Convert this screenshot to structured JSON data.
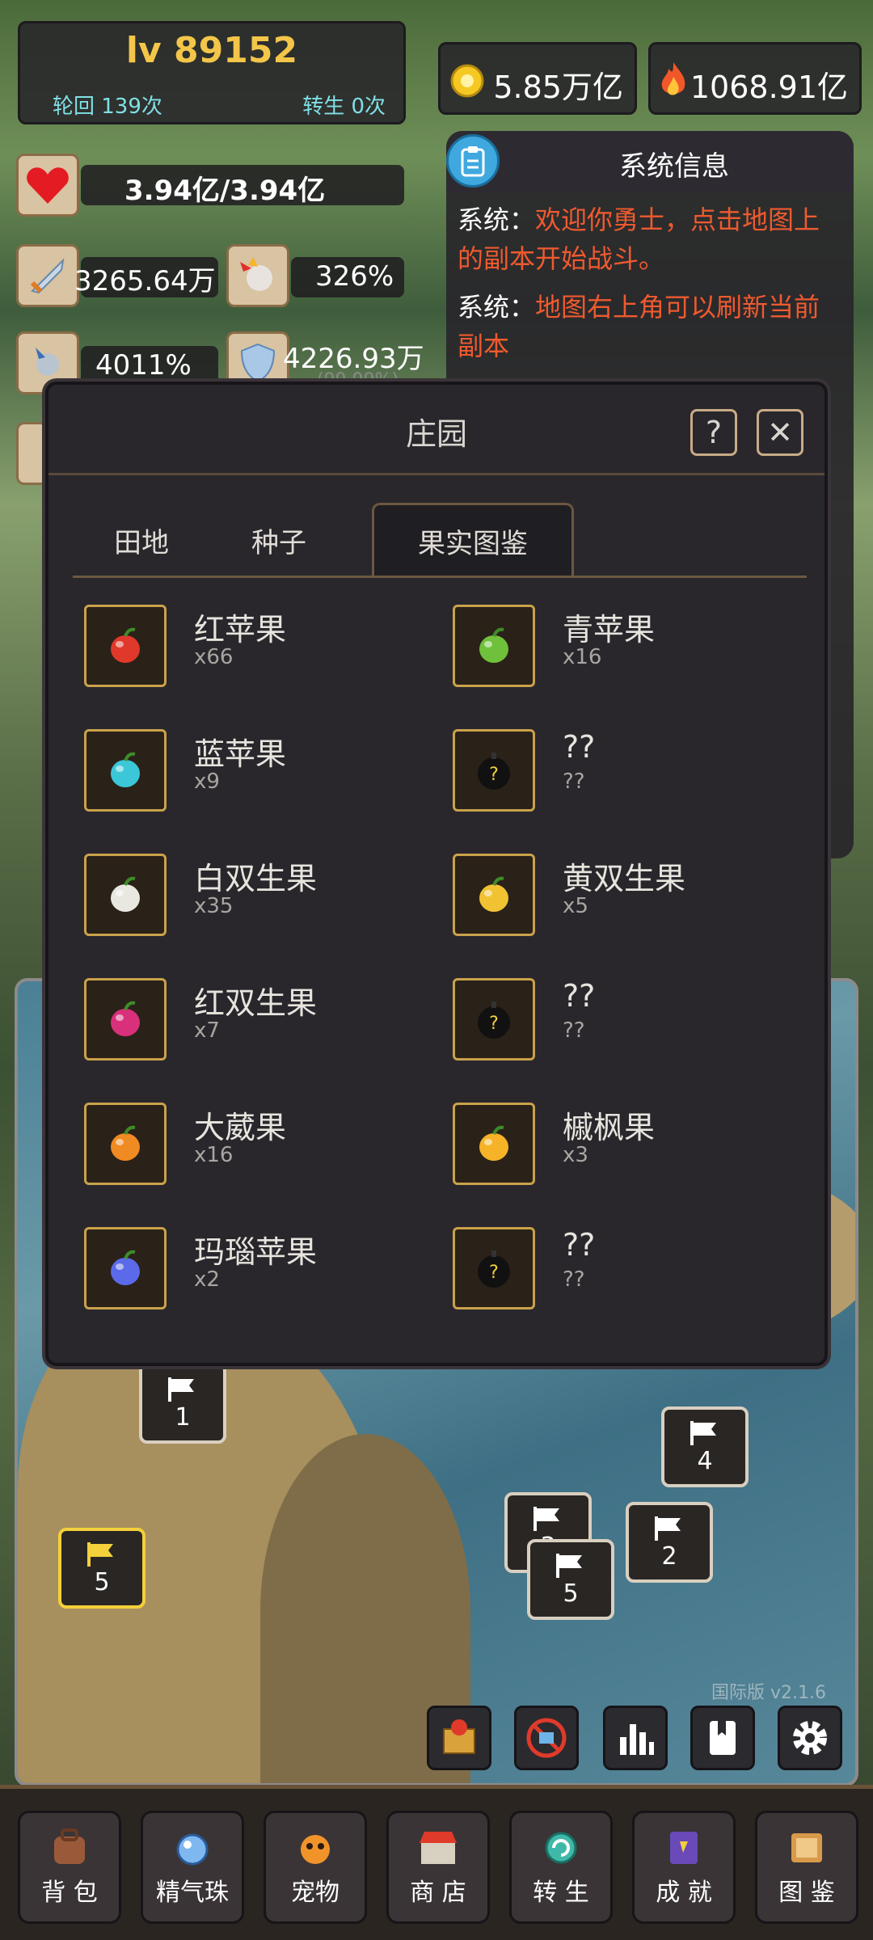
{
  "player": {
    "level": "lv 89152",
    "lunhui": "轮回 139次",
    "zhuansheng": "转生 0次"
  },
  "currency": {
    "coin": "5.85万亿",
    "power": "1068.91亿"
  },
  "stats": {
    "hp": "3.94亿/3.94亿",
    "attack": "3265.64万",
    "crit": "326%",
    "crit_dmg": "4011%",
    "defense": "4226.93万",
    "defense_sub": "(99.99%)"
  },
  "system": {
    "title": "系统信息",
    "messages": [
      {
        "who": "系统：",
        "text": "欢迎你勇士，点击地图上的副本开始战斗。"
      },
      {
        "who": "系统：",
        "text": "地图右上角可以刷新当前副本"
      }
    ]
  },
  "modal": {
    "title": "庄园",
    "help": "?",
    "close": "✕",
    "tabs": [
      "田地",
      "种子",
      "果实图鉴"
    ],
    "active_tab": "果实图鉴",
    "fruits": [
      {
        "name": "红苹果",
        "count": "x66",
        "color": "#e0382a"
      },
      {
        "name": "青苹果",
        "count": "x16",
        "color": "#6fc03a"
      },
      {
        "name": "蓝苹果",
        "count": "x9",
        "color": "#3bc7d8"
      },
      {
        "name": "??",
        "count": "??",
        "color": "#1a1a1a"
      },
      {
        "name": "白双生果",
        "count": "x35",
        "color": "#e8e8e0"
      },
      {
        "name": "黄双生果",
        "count": "x5",
        "color": "#f1c232"
      },
      {
        "name": "红双生果",
        "count": "x7",
        "color": "#d8307a"
      },
      {
        "name": "??",
        "count": "??",
        "color": "#1a1a1a"
      },
      {
        "name": "大葳果",
        "count": "x16",
        "color": "#f08a22"
      },
      {
        "name": "槭枫果",
        "count": "x3",
        "color": "#f6b327"
      },
      {
        "name": "玛瑙苹果",
        "count": "x2",
        "color": "#5a6ae8"
      },
      {
        "name": "??",
        "count": "??",
        "color": "#1a1a1a"
      }
    ]
  },
  "map": {
    "flags": [
      "1",
      "4",
      "3",
      "2",
      "5",
      "5"
    ],
    "version": "国际版 v2.1.6"
  },
  "nav": [
    "背 包",
    "精气珠",
    "宠物",
    "商 店",
    "转 生",
    "成 就",
    "图 鉴"
  ]
}
